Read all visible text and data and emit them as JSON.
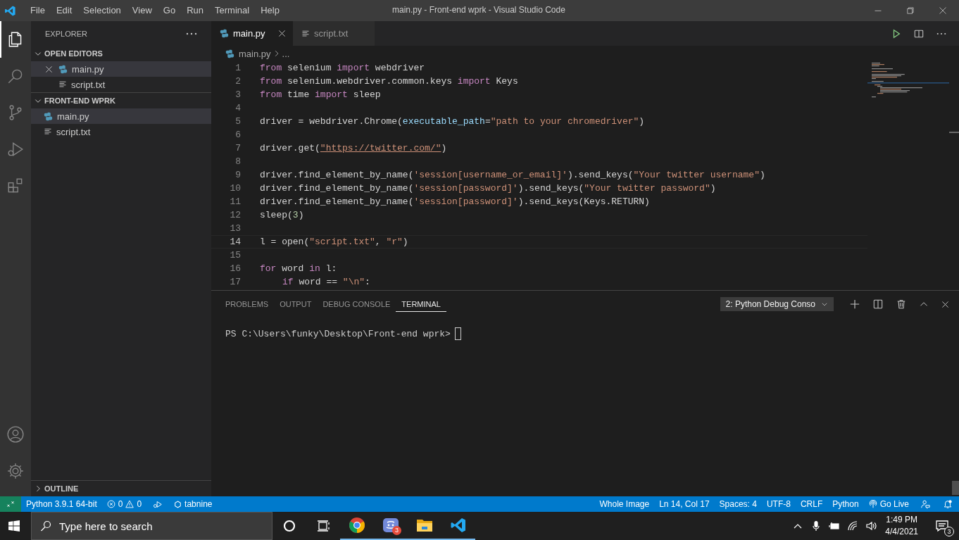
{
  "title_bar": {
    "menu": [
      "File",
      "Edit",
      "Selection",
      "View",
      "Go",
      "Run",
      "Terminal",
      "Help"
    ],
    "title": "main.py - Front-end wprk - Visual Studio Code"
  },
  "activity_bar": {
    "items": [
      {
        "kind": "files",
        "selected": true
      },
      {
        "kind": "search",
        "selected": false
      },
      {
        "kind": "scm",
        "selected": false
      },
      {
        "kind": "debug",
        "selected": false
      },
      {
        "kind": "extensions",
        "selected": false
      }
    ],
    "bottom_items": [
      {
        "kind": "account",
        "selected": false
      },
      {
        "kind": "manage",
        "selected": false
      }
    ]
  },
  "sidebar": {
    "title": "EXPLORER",
    "sections": [
      {
        "title": "OPEN EDITORS",
        "expanded": true,
        "items": [
          {
            "label": "main.py",
            "kind": "python",
            "selected": true,
            "closable": true
          },
          {
            "label": "script.txt",
            "kind": "text",
            "selected": false,
            "closable": false
          }
        ]
      },
      {
        "title": "FRONT-END WPRK",
        "expanded": true,
        "items": [
          {
            "label": "main.py",
            "kind": "python",
            "selected": true
          },
          {
            "label": "script.txt",
            "kind": "text",
            "selected": false
          }
        ]
      }
    ],
    "outline": {
      "title": "OUTLINE",
      "expanded": false
    }
  },
  "editor": {
    "tabs": [
      {
        "label": "main.py",
        "kind": "python",
        "selected": true
      },
      {
        "label": "script.txt",
        "kind": "text",
        "selected": false
      }
    ],
    "breadcrumb": [
      {
        "label": "main.py",
        "kind": "python"
      },
      {
        "label": "...",
        "kind": "text"
      }
    ],
    "lines": [
      {
        "number": "1",
        "current": false,
        "tokens": [
          {
            "kind": "kw",
            "text": "from"
          },
          {
            "kind": "plain",
            "text": " selenium "
          },
          {
            "kind": "kw",
            "text": "import"
          },
          {
            "kind": "plain",
            "text": " webdriver"
          }
        ]
      },
      {
        "number": "2",
        "current": false,
        "tokens": [
          {
            "kind": "kw",
            "text": "from"
          },
          {
            "kind": "plain",
            "text": " selenium.webdriver.common.keys "
          },
          {
            "kind": "kw",
            "text": "import"
          },
          {
            "kind": "plain",
            "text": " Keys"
          }
        ]
      },
      {
        "number": "3",
        "current": false,
        "tokens": [
          {
            "kind": "kw",
            "text": "from"
          },
          {
            "kind": "plain",
            "text": " time "
          },
          {
            "kind": "kw",
            "text": "import"
          },
          {
            "kind": "plain",
            "text": " sleep"
          }
        ]
      },
      {
        "number": "4",
        "current": false
      },
      {
        "number": "5",
        "current": false,
        "tokens": [
          {
            "kind": "plain",
            "text": "driver = webdriver.Chrome("
          },
          {
            "kind": "param",
            "text": "executable_path"
          },
          {
            "kind": "plain",
            "text": "="
          },
          {
            "kind": "str",
            "text": "\"path to your chromedriver\""
          },
          {
            "kind": "plain",
            "text": ")"
          }
        ]
      },
      {
        "number": "6",
        "current": false
      },
      {
        "number": "7",
        "current": false,
        "tokens": [
          {
            "kind": "plain",
            "text": "driver.get("
          },
          {
            "kind": "link",
            "text": "\"https://twitter.com/\""
          },
          {
            "kind": "plain",
            "text": ")"
          }
        ]
      },
      {
        "number": "8",
        "current": false
      },
      {
        "number": "9",
        "current": false,
        "tokens": [
          {
            "kind": "plain",
            "text": "driver.find_element_by_name("
          },
          {
            "kind": "str",
            "text": "'session[username_or_email]'"
          },
          {
            "kind": "plain",
            "text": ").send_keys("
          },
          {
            "kind": "str",
            "text": "\"Your twitter username\""
          },
          {
            "kind": "plain",
            "text": ")"
          }
        ]
      },
      {
        "number": "10",
        "current": false,
        "tokens": [
          {
            "kind": "plain",
            "text": "driver.find_element_by_name("
          },
          {
            "kind": "str",
            "text": "'session[password]'"
          },
          {
            "kind": "plain",
            "text": ").send_keys("
          },
          {
            "kind": "str",
            "text": "\"Your twitter password\""
          },
          {
            "kind": "plain",
            "text": ")"
          }
        ]
      },
      {
        "number": "11",
        "current": false,
        "tokens": [
          {
            "kind": "plain",
            "text": "driver.find_element_by_name("
          },
          {
            "kind": "str",
            "text": "'session[password]'"
          },
          {
            "kind": "plain",
            "text": ").send_keys(Keys.RETURN)"
          }
        ]
      },
      {
        "number": "12",
        "current": false,
        "tokens": [
          {
            "kind": "plain",
            "text": "sleep("
          },
          {
            "kind": "num",
            "text": "3"
          },
          {
            "kind": "plain",
            "text": ")"
          }
        ]
      },
      {
        "number": "13",
        "current": false
      },
      {
        "number": "14",
        "current": true,
        "tokens": [
          {
            "kind": "plain",
            "text": "l = open("
          },
          {
            "kind": "str",
            "text": "\"script.txt\""
          },
          {
            "kind": "plain",
            "text": ", "
          },
          {
            "kind": "str",
            "text": "\"r\""
          },
          {
            "kind": "plain",
            "text": ")"
          }
        ]
      },
      {
        "number": "15",
        "current": false
      },
      {
        "number": "16",
        "current": false,
        "tokens": [
          {
            "kind": "kw",
            "text": "for"
          },
          {
            "kind": "plain",
            "text": " word "
          },
          {
            "kind": "kw",
            "text": "in"
          },
          {
            "kind": "plain",
            "text": " l:"
          }
        ]
      },
      {
        "number": "17",
        "current": false,
        "indented": true,
        "tokens": [
          {
            "kind": "kw",
            "text": "if"
          },
          {
            "kind": "plain",
            "text": " word == "
          },
          {
            "kind": "str",
            "text": "\"\\n\""
          },
          {
            "kind": "plain",
            "text": ":"
          }
        ]
      }
    ]
  },
  "panel": {
    "tabs": [
      {
        "label": "PROBLEMS",
        "selected": false
      },
      {
        "label": "OUTPUT",
        "selected": false
      },
      {
        "label": "DEBUG CONSOLE",
        "selected": false
      },
      {
        "label": "TERMINAL",
        "selected": true
      }
    ],
    "terminal_select": "2: Python Debug Conso",
    "prompt": "PS C:\\Users\\funky\\Desktop\\Front-end wprk>"
  },
  "status_bar": {
    "left": [
      {
        "kind": "remote"
      },
      {
        "kind": "text",
        "text": "Python 3.9.1 64-bit"
      },
      {
        "kind": "problems",
        "errors": "0",
        "warnings": "0"
      },
      {
        "kind": "debug"
      },
      {
        "kind": "tabnine",
        "text": "tabnine"
      }
    ],
    "right": [
      {
        "kind": "text",
        "text": "Whole Image"
      },
      {
        "kind": "text",
        "text": "Ln 14, Col 17"
      },
      {
        "kind": "text",
        "text": "Spaces: 4"
      },
      {
        "kind": "text",
        "text": "UTF-8"
      },
      {
        "kind": "text",
        "text": "CRLF"
      },
      {
        "kind": "text",
        "text": "Python"
      },
      {
        "kind": "golive",
        "text": "Go Live"
      },
      {
        "kind": "feedback"
      },
      {
        "kind": "bell"
      }
    ]
  },
  "taskbar": {
    "search_placeholder": "Type here to search",
    "apps": [
      {
        "kind": "cortana",
        "running": false
      },
      {
        "kind": "taskview",
        "running": false
      },
      {
        "kind": "chrome",
        "running": true
      },
      {
        "kind": "discord",
        "running": true,
        "badge": "3"
      },
      {
        "kind": "folder",
        "running": true
      },
      {
        "kind": "vscode",
        "running": true
      }
    ],
    "tray": [
      {
        "kind": "chevron"
      },
      {
        "kind": "mic"
      },
      {
        "kind": "battery"
      },
      {
        "kind": "wifi"
      },
      {
        "kind": "volume"
      }
    ],
    "time": "1:49 PM",
    "date": "4/4/2021",
    "notifications": "3"
  }
}
